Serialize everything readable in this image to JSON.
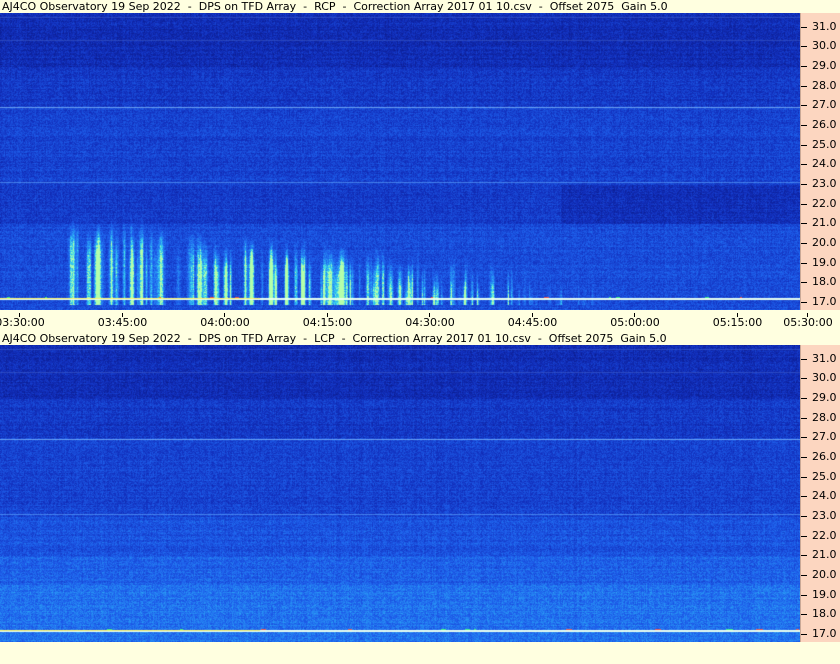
{
  "colors": {
    "background": "#ffffe0",
    "axis_panel": "#fcd6c0",
    "spectrogram_low": "#0a1e9a",
    "spectrogram_mid": "#1f5ee6",
    "spectrogram_high": "#40f0e0"
  },
  "chart_data": [
    {
      "type": "heatmap",
      "title": "AJ4CO Observatory 19 Sep 2022  -  DPS on TFD Array  -  RCP  -  Correction Array 2017 01 10.csv  -  Offset 2075  Gain 5.0",
      "x_tick_labels": [
        "03:30:00",
        "03:45:00",
        "04:00:00",
        "04:15:00",
        "04:30:00",
        "04:45:00",
        "05:00:00",
        "05:15:00",
        "05:30:00"
      ],
      "y_tick_labels": [
        "31.0",
        "30.0",
        "29.0",
        "28.0",
        "27.0",
        "26.0",
        "25.0",
        "24.0",
        "23.0",
        "22.0",
        "21.0",
        "20.0",
        "19.0",
        "18.0",
        "17.0"
      ],
      "xlim": [
        "03:30:00",
        "05:30:00"
      ],
      "ylim": [
        16.6,
        31.7
      ],
      "polarization": "RCP",
      "features": {
        "burst_start": "03:40:00",
        "burst_end": "05:00:00",
        "burst_top_freq_start": 22.0,
        "burst_top_freq_end": 18.5,
        "interference_freq": 17.2
      }
    },
    {
      "type": "heatmap",
      "title": "AJ4CO Observatory 19 Sep 2022  -  DPS on TFD Array  -  LCP  -  Correction Array 2017 01 10.csv  -  Offset 2075  Gain 5.0",
      "x_tick_labels": [],
      "y_tick_labels": [
        "31.0",
        "30.0",
        "29.0",
        "28.0",
        "27.0",
        "26.0",
        "25.0",
        "24.0",
        "23.0",
        "22.0",
        "21.0",
        "20.0",
        "19.0",
        "18.0",
        "17.0"
      ],
      "xlim": [
        "03:30:00",
        "05:30:00"
      ],
      "ylim": [
        16.6,
        31.7
      ],
      "polarization": "LCP",
      "features": {
        "interference_freq": 17.2
      }
    }
  ]
}
